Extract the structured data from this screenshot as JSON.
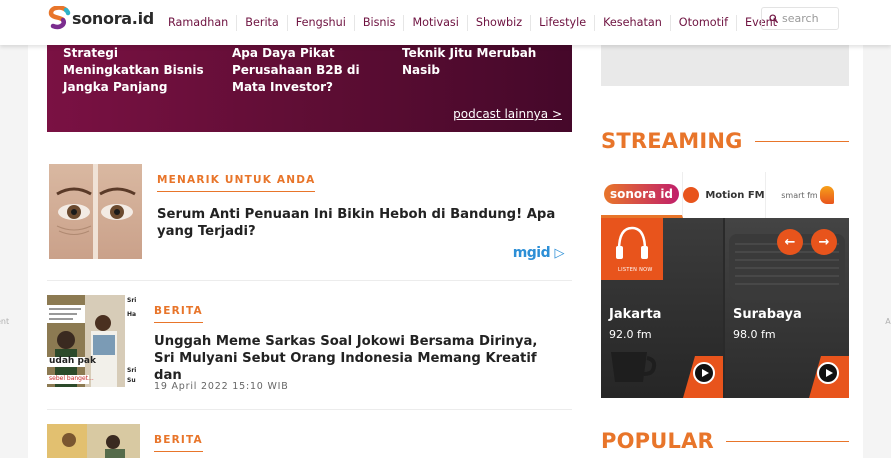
{
  "header": {
    "logo_text": "sonora.id",
    "nav": [
      "Ramadhan",
      "Berita",
      "Fengshui",
      "Bisnis",
      "Motivasi",
      "Showbiz",
      "Lifestyle",
      "Kesehatan",
      "Otomotif",
      "Event"
    ],
    "search_placeholder": "search"
  },
  "side": {
    "left_label": "ent",
    "right_label": "Ac"
  },
  "podcast": {
    "items": [
      "Strategi Meningkatkan Bisnis Jangka Panjang",
      "Apa Daya Pikat Perusahaan B2B di Mata Investor?",
      "Teknik Jitu Merubah Nasib"
    ],
    "more_link": "podcast lainnya >"
  },
  "articles": [
    {
      "kicker": "MENARIK UNTUK ANDA",
      "title": "Serum Anti Penuaan Ini Bikin Heboh di Bandung! Apa yang Terjadi?",
      "sponsor": "mgid"
    },
    {
      "kicker": "BERITA",
      "title": "Unggah Meme Sarkas Soal Jokowi Bersama Dirinya, Sri Mulyani Sebut Orang Indonesia Memang Kreatif dan",
      "date": "19 April 2022",
      "time": "15:10",
      "tz": "WIB",
      "thumb_texts": [
        "udah pak",
        "sebel banget...",
        "Sri",
        "Ha",
        "Sri",
        "Su"
      ]
    },
    {
      "kicker": "BERITA"
    }
  ],
  "streaming": {
    "title": "STREAMING",
    "stations": [
      {
        "name": "sonora id"
      },
      {
        "name": "Motion FM"
      },
      {
        "name": "smart fm"
      }
    ],
    "listen_now": "LISTEN NOW",
    "prev_icon": "←",
    "next_icon": "→",
    "cities": [
      {
        "name": "Jakarta",
        "freq": "92.0 fm"
      },
      {
        "name": "Surabaya",
        "freq": "98.0 fm"
      }
    ]
  },
  "popular": {
    "title": "POPULAR"
  },
  "colors": {
    "accent": "#e8752a",
    "brand": "#6e1240",
    "podcast_bg": "#5c0d33"
  }
}
